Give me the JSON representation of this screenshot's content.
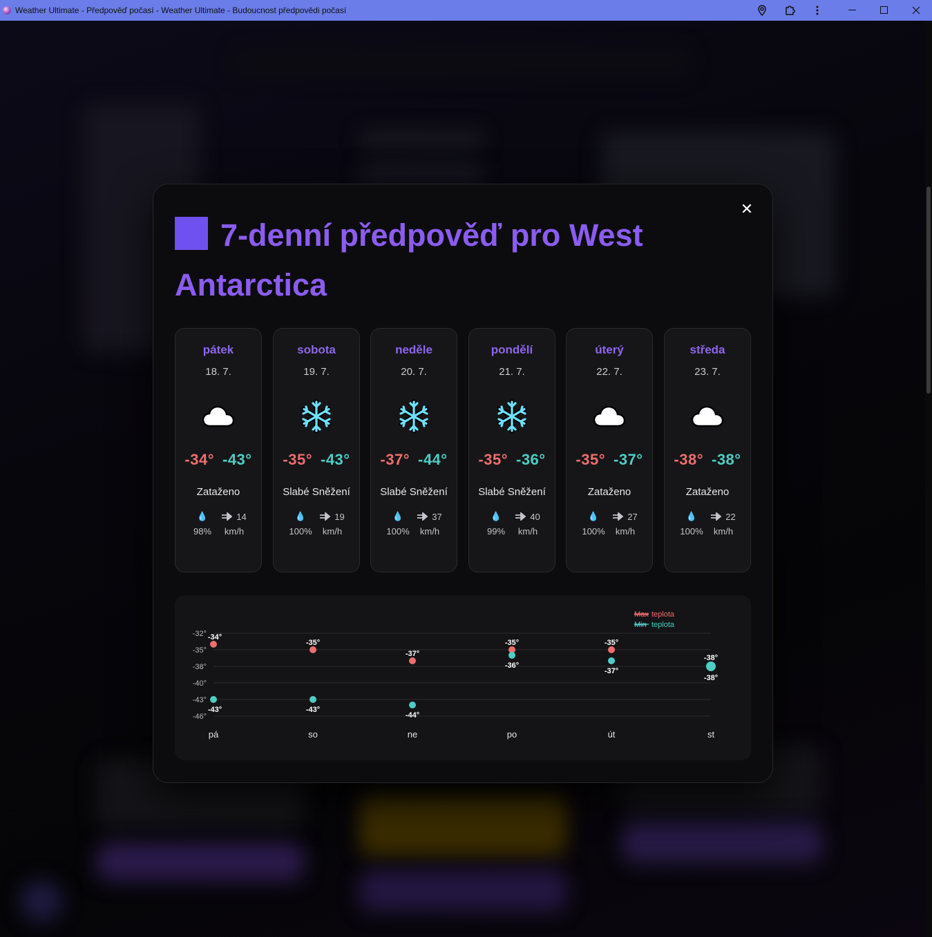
{
  "window": {
    "title": "Weather Ultimate - Předpověď počasí - Weather Ultimate - Budoucnost předpovědi počasí"
  },
  "titlebar_icons": [
    "location-pin-icon",
    "extensions-icon",
    "more-vertical-icon"
  ],
  "modal": {
    "title": "7-denní předpověď pro West Antarctica",
    "close_label": "✕",
    "days": [
      {
        "day": "pátek",
        "date": "18. 7.",
        "icon": "cloud-icon",
        "max": "-34°",
        "min": "-43°",
        "desc": "Zataženo",
        "humidity": "98%",
        "wind": "14",
        "wind_unit": "km/h"
      },
      {
        "day": "sobota",
        "date": "19. 7.",
        "icon": "snowflake-icon",
        "max": "-35°",
        "min": "-43°",
        "desc": "Slabé Sněžení",
        "humidity": "100%",
        "wind": "19",
        "wind_unit": "km/h"
      },
      {
        "day": "neděle",
        "date": "20. 7.",
        "icon": "snowflake-icon",
        "max": "-37°",
        "min": "-44°",
        "desc": "Slabé Sněžení",
        "humidity": "100%",
        "wind": "37",
        "wind_unit": "km/h"
      },
      {
        "day": "pondělí",
        "date": "21. 7.",
        "icon": "snowflake-icon",
        "max": "-35°",
        "min": "-36°",
        "desc": "Slabé Sněžení",
        "humidity": "99%",
        "wind": "40",
        "wind_unit": "km/h"
      },
      {
        "day": "úterý",
        "date": "22. 7.",
        "icon": "cloud-icon",
        "max": "-35°",
        "min": "-37°",
        "desc": "Zataženo",
        "humidity": "100%",
        "wind": "27",
        "wind_unit": "km/h"
      },
      {
        "day": "středa",
        "date": "23. 7.",
        "icon": "cloud-icon",
        "max": "-38°",
        "min": "-38°",
        "desc": "Zataženo",
        "humidity": "100%",
        "wind": "22",
        "wind_unit": "km/h"
      }
    ]
  },
  "chart_data": {
    "type": "scatter",
    "categories": [
      "pá",
      "so",
      "ne",
      "po",
      "út",
      "st"
    ],
    "series": [
      {
        "name": "Max teplota",
        "values": [
          -34,
          -35,
          -37,
          -35,
          -35,
          -38
        ],
        "color": "#ee6e6e",
        "labels": [
          "-34°",
          "-35°",
          "-37°",
          "-35°",
          "-35°",
          "-38°"
        ]
      },
      {
        "name": "Min teplota",
        "values": [
          -43,
          -43,
          -44,
          -36,
          -37,
          -38
        ],
        "color": "#4ecdc4",
        "labels": [
          "-43°",
          "-43°",
          "-44°",
          "-36°",
          "-37°",
          "-38°"
        ]
      }
    ],
    "legend": [
      "Max teplota",
      "Min teplota"
    ],
    "legend_words": [
      {
        "struck": "Max",
        "rest": "teplota"
      },
      {
        "struck": "Min",
        "rest": "teplota"
      }
    ],
    "legend_position": "top-right",
    "yticks": [
      -32,
      -35,
      -38,
      -40,
      -43,
      -46
    ],
    "ytick_labels": [
      "-32°",
      "-35°",
      "-38°",
      "-40°",
      "-43°",
      "-46°"
    ],
    "ylim": [
      -46,
      -32
    ],
    "grid": true
  }
}
